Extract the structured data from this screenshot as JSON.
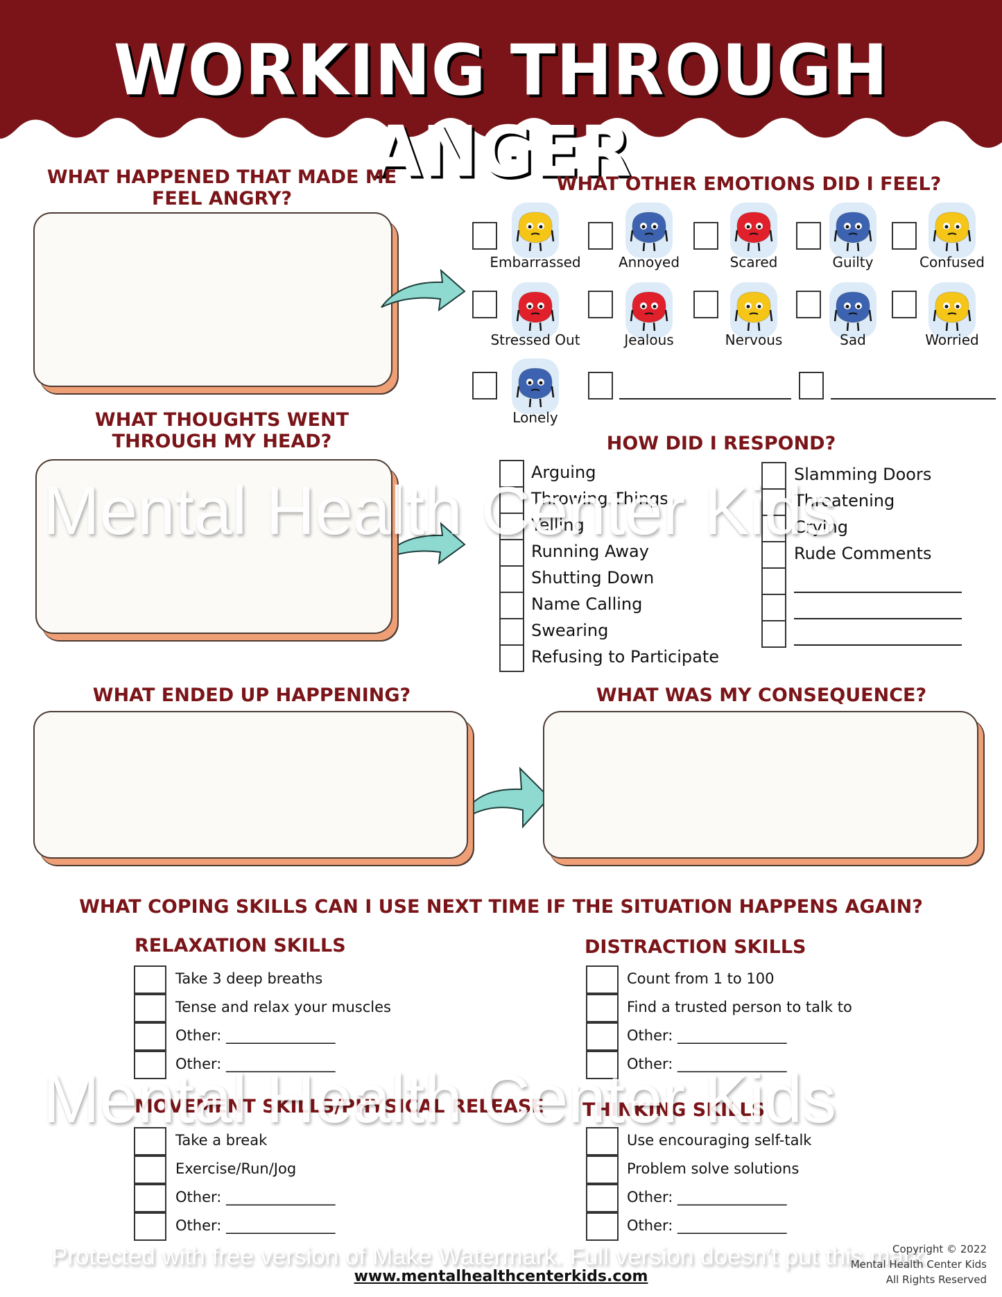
{
  "header": {
    "title": "WORKING THROUGH ANGER",
    "band_color": "#7a1418"
  },
  "sections": {
    "what_happened": {
      "heading_line1": "WHAT HAPPENED THAT MADE ME",
      "heading_line2": "FEEL ANGRY?"
    },
    "thoughts": {
      "heading_line1": "WHAT THOUGHTS WENT",
      "heading_line2": "THROUGH MY HEAD?"
    },
    "ended_up": {
      "heading": "WHAT ENDED UP HAPPENING?"
    },
    "consequence": {
      "heading": "WHAT WAS MY CONSEQUENCE?"
    }
  },
  "emotions": {
    "heading": "WHAT OTHER EMOTIONS DID I FEEL?",
    "items": [
      {
        "label": "Embarrassed",
        "icon": "yellow-brain-blushing",
        "color": "#f5c518"
      },
      {
        "label": "Annoyed",
        "icon": "blue-brain-annoyed",
        "color": "#3d63b0"
      },
      {
        "label": "Scared",
        "icon": "red-brain-scared",
        "color": "#e0202a"
      },
      {
        "label": "Guilty",
        "icon": "blue-brain-guilty",
        "color": "#3d63b0"
      },
      {
        "label": "Confused",
        "icon": "yellow-brain-confused",
        "color": "#f5c518"
      },
      {
        "label": "Stressed Out",
        "icon": "red-brain-stressed",
        "color": "#e0202a"
      },
      {
        "label": "Jealous",
        "icon": "red-brain-jealous",
        "color": "#e0202a"
      },
      {
        "label": "Nervous",
        "icon": "yellow-brain-nervous",
        "color": "#f5c518"
      },
      {
        "label": "Sad",
        "icon": "blue-brain-sad",
        "color": "#3d63b0"
      },
      {
        "label": "Worried",
        "icon": "yellow-brain-worried",
        "color": "#f5c518"
      },
      {
        "label": "Lonely",
        "icon": "blue-brain-lonely",
        "color": "#3d63b0"
      }
    ]
  },
  "respond": {
    "heading": "HOW DID I RESPOND?",
    "left": [
      "Arguing",
      "Throwing Things",
      "Yelling",
      "Running Away",
      "Shutting Down",
      "Name Calling",
      "Swearing",
      "Refusing to Participate"
    ],
    "right": [
      "Slamming Doors",
      "Threatening",
      "Crying",
      "Rude Comments"
    ]
  },
  "coping": {
    "heading": "WHAT COPING SKILLS CAN I USE NEXT TIME IF THE SITUATION HAPPENS AGAIN?",
    "groups": [
      {
        "title": "RELAXATION SKILLS",
        "items": [
          "Take 3 deep breaths",
          "Tense and relax your muscles",
          "Other: _______________",
          "Other: _______________"
        ]
      },
      {
        "title": "DISTRACTION SKILLS",
        "items": [
          "Count from 1 to 100",
          "Find a trusted person to talk to",
          "Other: _______________",
          "Other: _______________"
        ]
      },
      {
        "title": "MOVEMENT SKILLS/PHYSICAL RELEASE",
        "items": [
          "Take a break",
          "Exercise/Run/Jog",
          "Other: _______________",
          "Other: _______________"
        ]
      },
      {
        "title": "THINKING SKILLS",
        "items": [
          "Use encouraging self-talk",
          "Problem solve solutions",
          "Other: _______________",
          "Other: _______________"
        ]
      }
    ]
  },
  "watermarks": {
    "brand": "Mental Health Center Kids",
    "notice": "Protected with free version of Make Watermark. Full version doesn't put this mark."
  },
  "footer": {
    "url": "www.mentalhealthcenterkids.com",
    "copyright_line1": "Copyright © 2022",
    "copyright_line2": "Mental Health Center Kids",
    "copyright_line3": "All Rights Reserved"
  }
}
